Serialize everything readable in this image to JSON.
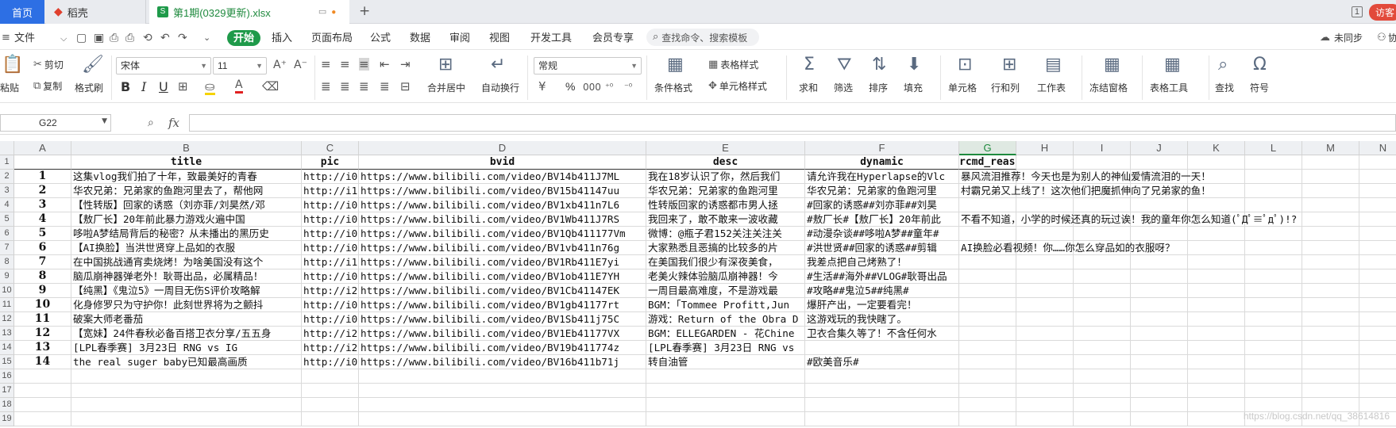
{
  "tabs": [
    {
      "label": "首页",
      "icon": "home-icon"
    },
    {
      "label": "稻壳",
      "icon": "daoke-logo-icon"
    },
    {
      "label": "第1期(0329更新).xlsx",
      "icon": "spreadsheet-file-icon"
    }
  ],
  "tab_actions": {
    "badge": "1",
    "visitor": "访客"
  },
  "menu": {
    "file": "文件",
    "tabs": [
      "开始",
      "插入",
      "页面布局",
      "公式",
      "数据",
      "审阅",
      "视图",
      "开发工具",
      "会员专享"
    ],
    "active_tab": "开始",
    "search_placeholder": "查找命令、搜索模板",
    "sync": "未同步",
    "collab": "协"
  },
  "ribbon": {
    "paste": "粘贴",
    "cut": "剪切",
    "copy": "复制",
    "format_painter": "格式刷",
    "font_name": "宋体",
    "font_size": "11",
    "merge_center": "合并居中",
    "wrap_text": "自动换行",
    "number_format": "常规",
    "conditional_format": "条件格式",
    "table_style": "表格样式",
    "cell_style": "单元格样式",
    "sum": "求和",
    "filter": "筛选",
    "sort": "排序",
    "fill": "填充",
    "cells": "单元格",
    "rows_cols": "行和列",
    "worksheet": "工作表",
    "freeze": "冻结窗格",
    "table_tools": "表格工具",
    "find": "查找",
    "symbol": "符号",
    "bold": "B",
    "italic": "I",
    "underline": "U",
    "percent": "%"
  },
  "formula_bar": {
    "name_box": "G22",
    "fx": "fx",
    "value": ""
  },
  "columns": [
    "A",
    "B",
    "C",
    "D",
    "E",
    "F",
    "G",
    "H",
    "I",
    "J",
    "K",
    "L",
    "M",
    "N"
  ],
  "selected_column": "G",
  "rows": [
    "1",
    "2",
    "3",
    "4",
    "5",
    "6",
    "7",
    "8",
    "9",
    "10",
    "11",
    "12",
    "13",
    "14",
    "15",
    "16",
    "17",
    "18",
    "19"
  ],
  "headers": {
    "title": "title",
    "pic": "pic",
    "bvid": "bvid",
    "desc": "desc",
    "dynamic": "dynamic",
    "rcmd_reason": "rcmd_reason"
  },
  "records": [
    {
      "num": "1",
      "title": "这集vlog我们拍了十年，致最美好的青春",
      "pic": "http://i0",
      "bvid": "https://www.bilibili.com/video/BV14b411J7ML",
      "desc": "我在18岁认识了你，然后我们",
      "dynamic": "请允许我在Hyperlapse的Vlc",
      "rcmd": "暴风流泪推荐！今天也是为别人的神仙爱情流泪的一天！"
    },
    {
      "num": "2",
      "title": "华农兄弟：兄弟家的鱼跑河里去了，帮他网",
      "pic": "http://i1",
      "bvid": "https://www.bilibili.com/video/BV15b41147uu",
      "desc": "华农兄弟：兄弟家的鱼跑河里",
      "dynamic": "华农兄弟：兄弟家的鱼跑河里",
      "rcmd": "村霸兄弟又上线了！这次他们把魔抓伸向了兄弟家的鱼！"
    },
    {
      "num": "3",
      "title": "【性转版】回家的诱惑（刘亦菲/刘昊然/邓",
      "pic": "http://i0",
      "bvid": "https://www.bilibili.com/video/BV1xb411n7L6",
      "desc": "性转版回家的诱惑都市男人拯",
      "dynamic": "#回家的诱惑##刘亦菲##刘昊",
      "rcmd": ""
    },
    {
      "num": "4",
      "title": "【敖厂长】20年前此暴力游戏火遍中国",
      "pic": "http://i0",
      "bvid": "https://www.bilibili.com/video/BV1Wb411J7RS",
      "desc": "我回来了，敢不敢来一波收藏",
      "dynamic": "#敖厂长#【敖厂长】20年前此",
      "rcmd": "不看不知道，小学的时候还真的玩过诶！我的童年你怎么知道(ﾟДﾟ≡ﾟдﾟ)!?"
    },
    {
      "num": "5",
      "title": "哆啦A梦结局背后的秘密？从未播出的黑历史",
      "pic": "http://i0",
      "bvid": "https://www.bilibili.com/video/BV1Qb411177Vm",
      "desc": "微博：@瓶子君152关注关注关",
      "dynamic": "#动漫杂谈##哆啦A梦##童年#",
      "rcmd": ""
    },
    {
      "num": "6",
      "title": "【AI换脸】当洪世贤穿上品如的衣服",
      "pic": "http://i0",
      "bvid": "https://www.bilibili.com/video/BV1vb411n76g",
      "desc": "大家熟悉且恶搞的比较多的片",
      "dynamic": "#洪世贤##回家的诱惑##剪辑",
      "rcmd": "AI换脸必看视频！你……你怎么穿品如的衣服呀？"
    },
    {
      "num": "7",
      "title": "在中国挑战通宵卖烧烤！为啥美国没有这个",
      "pic": "http://i1",
      "bvid": "https://www.bilibili.com/video/BV1Rb411E7yi",
      "desc": "在美国我们很少有深夜美食，",
      "dynamic": "我差点把自己烤熟了！",
      "rcmd": ""
    },
    {
      "num": "8",
      "title": "脑瓜崩神器弹老外！耿哥出品，必属精品！",
      "pic": "http://i0",
      "bvid": "https://www.bilibili.com/video/BV1ob411E7YH",
      "desc": "老美火辣体验脑瓜崩神器！今",
      "dynamic": "#生活##海外##VLOG#耿哥出品",
      "rcmd": ""
    },
    {
      "num": "9",
      "title": "【纯黑】《鬼泣5》一周目无伤S评价攻略解",
      "pic": "http://i2",
      "bvid": "https://www.bilibili.com/video/BV1Cb41147EK",
      "desc": "一周目最高难度，不是游戏最",
      "dynamic": "#攻略##鬼泣5##纯黑#",
      "rcmd": ""
    },
    {
      "num": "10",
      "title": "化身修罗只为守护你！此刻世界将为之颤抖",
      "pic": "http://i0",
      "bvid": "https://www.bilibili.com/video/BV1gb41177rt",
      "desc": "BGM：「Tommee Profitt,Jun",
      "dynamic": "爆肝产出，一定要看完！",
      "rcmd": ""
    },
    {
      "num": "11",
      "title": "破案大师老番茄",
      "pic": "http://i0",
      "bvid": "https://www.bilibili.com/video/BV1Sb411j75C",
      "desc": "游戏：Return of the Obra D",
      "dynamic": "这游戏玩的我快瞎了。",
      "rcmd": ""
    },
    {
      "num": "12",
      "title": "【宽妹】24件春秋必备百搭卫衣分享/五五身",
      "pic": "http://i2",
      "bvid": "https://www.bilibili.com/video/BV1Eb41177VX",
      "desc": "BGM：ELLEGARDEN - 花Chine",
      "dynamic": "卫衣合集久等了！不含任何水",
      "rcmd": ""
    },
    {
      "num": "13",
      "title": "[LPL春季赛] 3月23日 RNG vs IG",
      "pic": "http://i2",
      "bvid": "https://www.bilibili.com/video/BV19b411774z",
      "desc": "[LPL春季赛] 3月23日 RNG vs",
      "dynamic": "",
      "rcmd": ""
    },
    {
      "num": "14",
      "title": "the real suger baby已知最高画质",
      "pic": "http://i0",
      "bvid": "https://www.bilibili.com/video/BV16b411b71j",
      "desc": "转自油管",
      "dynamic": "#欧美音乐#",
      "rcmd": ""
    }
  ],
  "watermark": "https://blog.csdn.net/qq_38614816"
}
